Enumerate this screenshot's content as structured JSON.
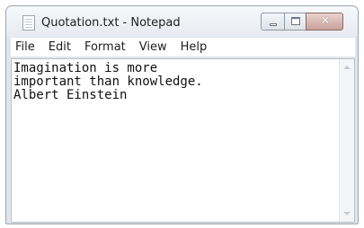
{
  "window": {
    "title": "Quotation.txt - Notepad"
  },
  "menu": {
    "items": [
      "File",
      "Edit",
      "Format",
      "View",
      "Help"
    ]
  },
  "editor": {
    "lines": [
      "Imagination is more",
      "important than knowledge.",
      "Albert Einstein"
    ]
  },
  "icons": {
    "app": "notepad-icon",
    "minimize": "minimize-icon",
    "maximize": "maximize-icon",
    "close": "close-icon",
    "scroll_up": "scroll-up-arrow-icon",
    "scroll_down": "scroll-down-arrow-icon"
  },
  "colors": {
    "title_bar": "#e6ebf0",
    "close_button": "#c9a19a",
    "editor_background": "#ffffff"
  }
}
